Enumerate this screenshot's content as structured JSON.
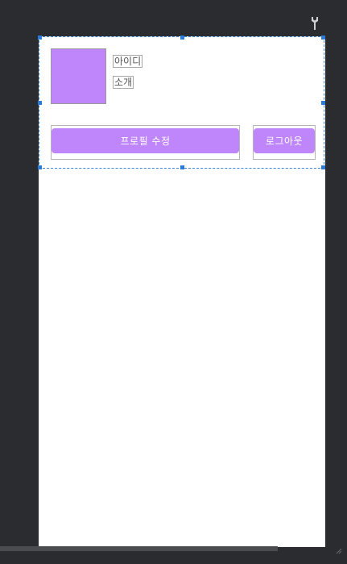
{
  "toolbar": {
    "icon": "wrench-icon"
  },
  "layout_preview": {
    "profile_image": {
      "color": "#bf86fb"
    },
    "text_id": "아이디",
    "text_intro": "소개",
    "buttons": {
      "edit_profile": "프로필 수정",
      "logout": "로그아웃",
      "color": "#bf86fb"
    },
    "selection_color": "#3b84d6"
  }
}
